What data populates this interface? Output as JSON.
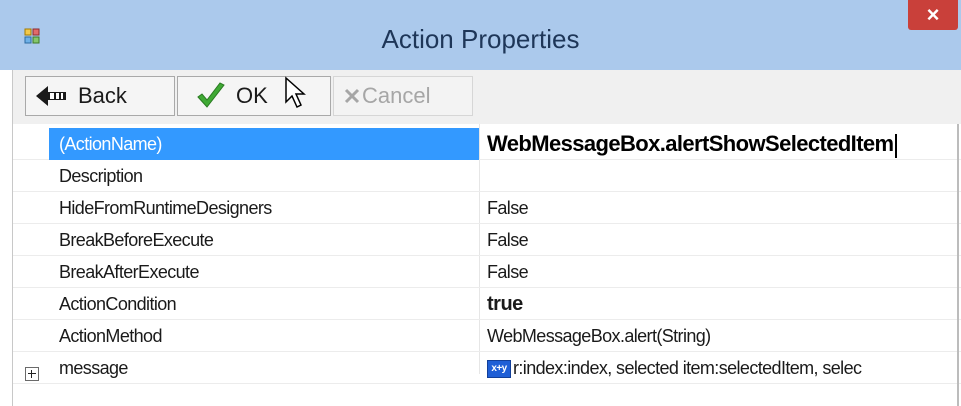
{
  "window": {
    "title": "Action Properties",
    "close_symbol": "×"
  },
  "toolbar": {
    "back_label": "Back",
    "ok_label": "OK",
    "cancel_label": "Cancel"
  },
  "properties": [
    {
      "name": "(ActionName)",
      "value": "WebMessageBox.alertShowSelectedItem"
    },
    {
      "name": "Description",
      "value": ""
    },
    {
      "name": "HideFromRuntimeDesigners",
      "value": "False"
    },
    {
      "name": "BreakBeforeExecute",
      "value": "False"
    },
    {
      "name": "BreakAfterExecute",
      "value": "False"
    },
    {
      "name": "ActionCondition",
      "value": "true"
    },
    {
      "name": "ActionMethod",
      "value": "WebMessageBox.alert(String)"
    },
    {
      "name": "message",
      "value_badge": "x+y",
      "value": "r:index:index, selected item:selectedItem, selec"
    }
  ],
  "colors": {
    "title_bar": "#abc9ec",
    "close_button": "#c9403a",
    "selection": "#3399ff",
    "ok_check": "#3fa934"
  },
  "icons": {
    "app": "app-icon",
    "close": "close-icon",
    "back": "back-arrow-icon",
    "ok": "check-icon",
    "cancel": "x-icon",
    "cursor": "mouse-pointer-icon",
    "expand": "plus-expander-icon",
    "value_badge": "code-badge-icon"
  }
}
